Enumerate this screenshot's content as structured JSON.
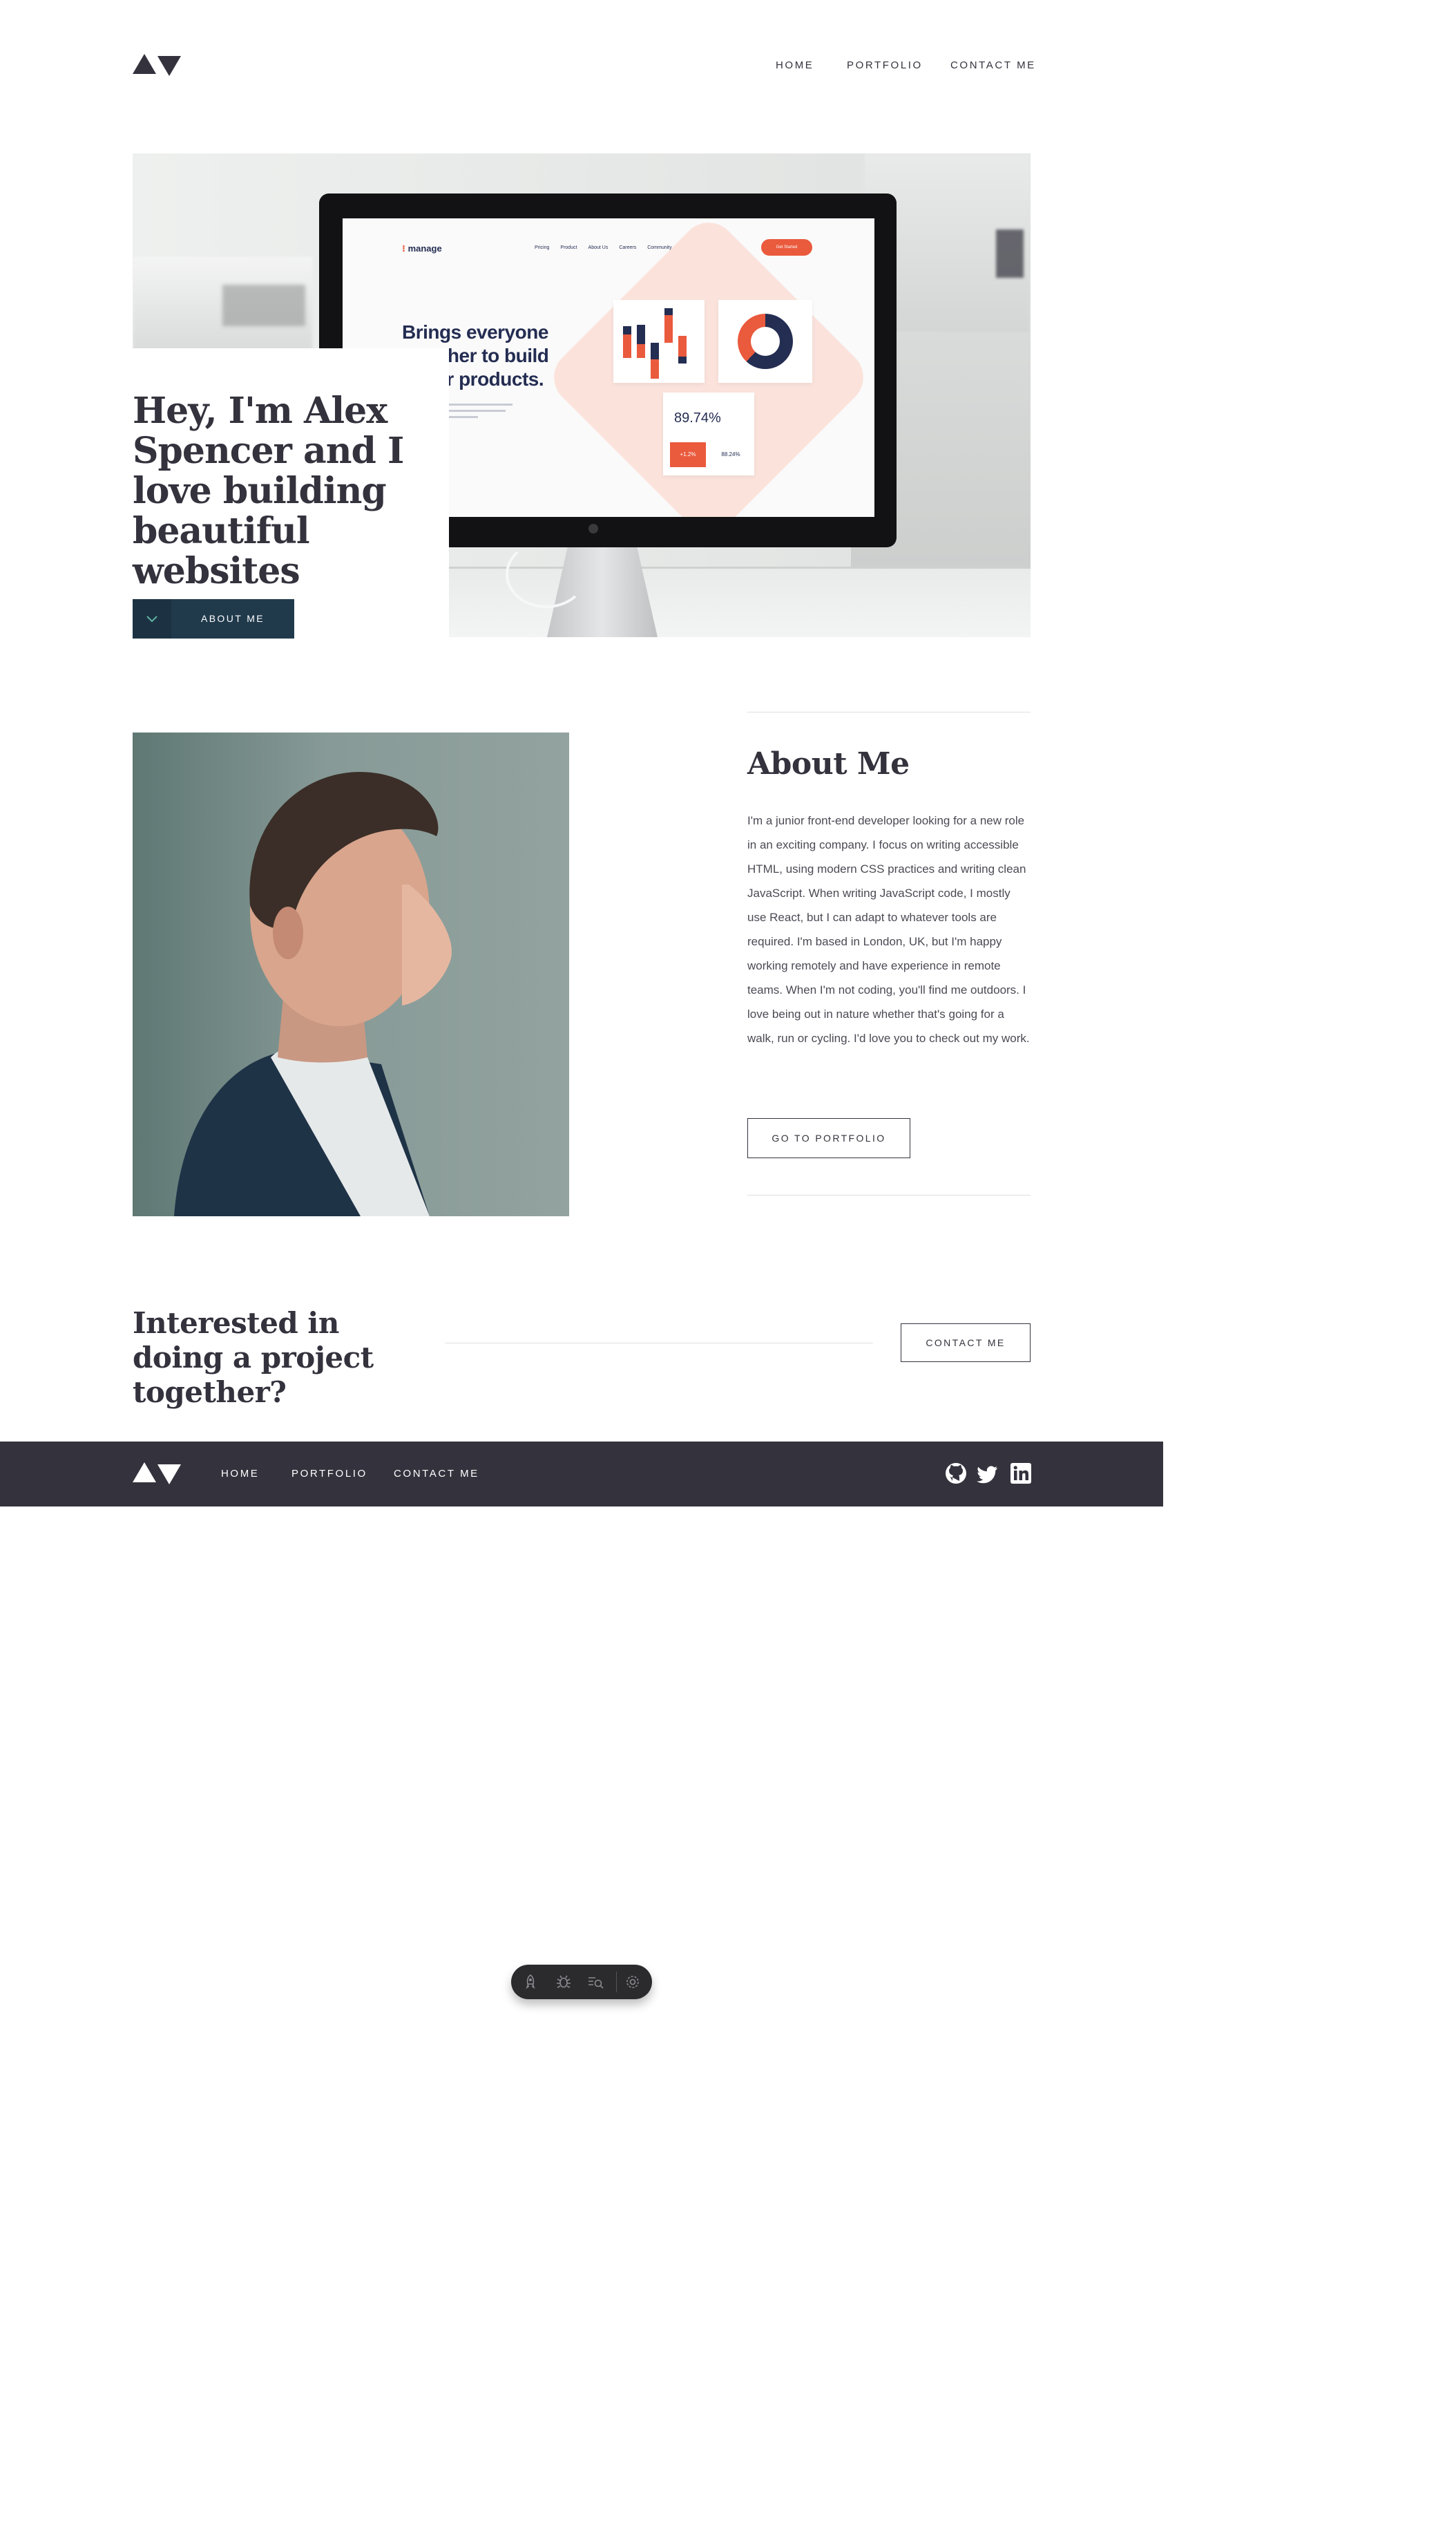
{
  "header": {
    "logo_alt": "AV logo",
    "nav": [
      {
        "label": "HOME"
      },
      {
        "label": "PORTFOLIO"
      },
      {
        "label": "CONTACT ME"
      }
    ]
  },
  "hero": {
    "title": "Hey, I'm Alex Spencer and I love building beautiful websites",
    "button_label": "ABOUT ME",
    "button_icon": "chevron-down-icon",
    "mockup": {
      "brand": "manage",
      "nav": [
        "Pricing",
        "Product",
        "About Us",
        "Careers",
        "Community"
      ],
      "cta": "Get Started",
      "headline": [
        "Brings everyone",
        "together to build",
        "better products."
      ],
      "stat": "89.74%",
      "chip_a": "+1.2%",
      "chip_b": "88.24%"
    }
  },
  "about": {
    "title": "About Me",
    "body": "I'm a junior front-end developer looking for a new role in an exciting company. I focus on writing accessible HTML, using modern CSS practices and writing clean JavaScript. When writing JavaScript code, I mostly use React, but I can adapt to whatever tools are required. I'm based in London, UK, but I'm happy working remotely and have experience in remote teams. When I'm not coding, you'll find me outdoors. I love being out in nature whether that's going for a walk, run or cycling. I'd love you to check out my work.",
    "button_label": "GO TO PORTFOLIO"
  },
  "cta": {
    "title": "Interested in doing a project together?",
    "button_label": "CONTACT ME"
  },
  "footer": {
    "nav": [
      {
        "label": "HOME"
      },
      {
        "label": "PORTFOLIO"
      },
      {
        "label": "CONTACT ME"
      }
    ],
    "social": [
      "github-icon",
      "twitter-icon",
      "linkedin-icon"
    ]
  },
  "toolbar": {
    "icons": [
      "rocket-icon",
      "bug-icon",
      "list-search-icon",
      "settings-icon"
    ]
  },
  "colors": {
    "dark": "#33323d",
    "navy": "#203a4c",
    "orange": "#ea5a3d",
    "footer_bg": "#33323d"
  }
}
